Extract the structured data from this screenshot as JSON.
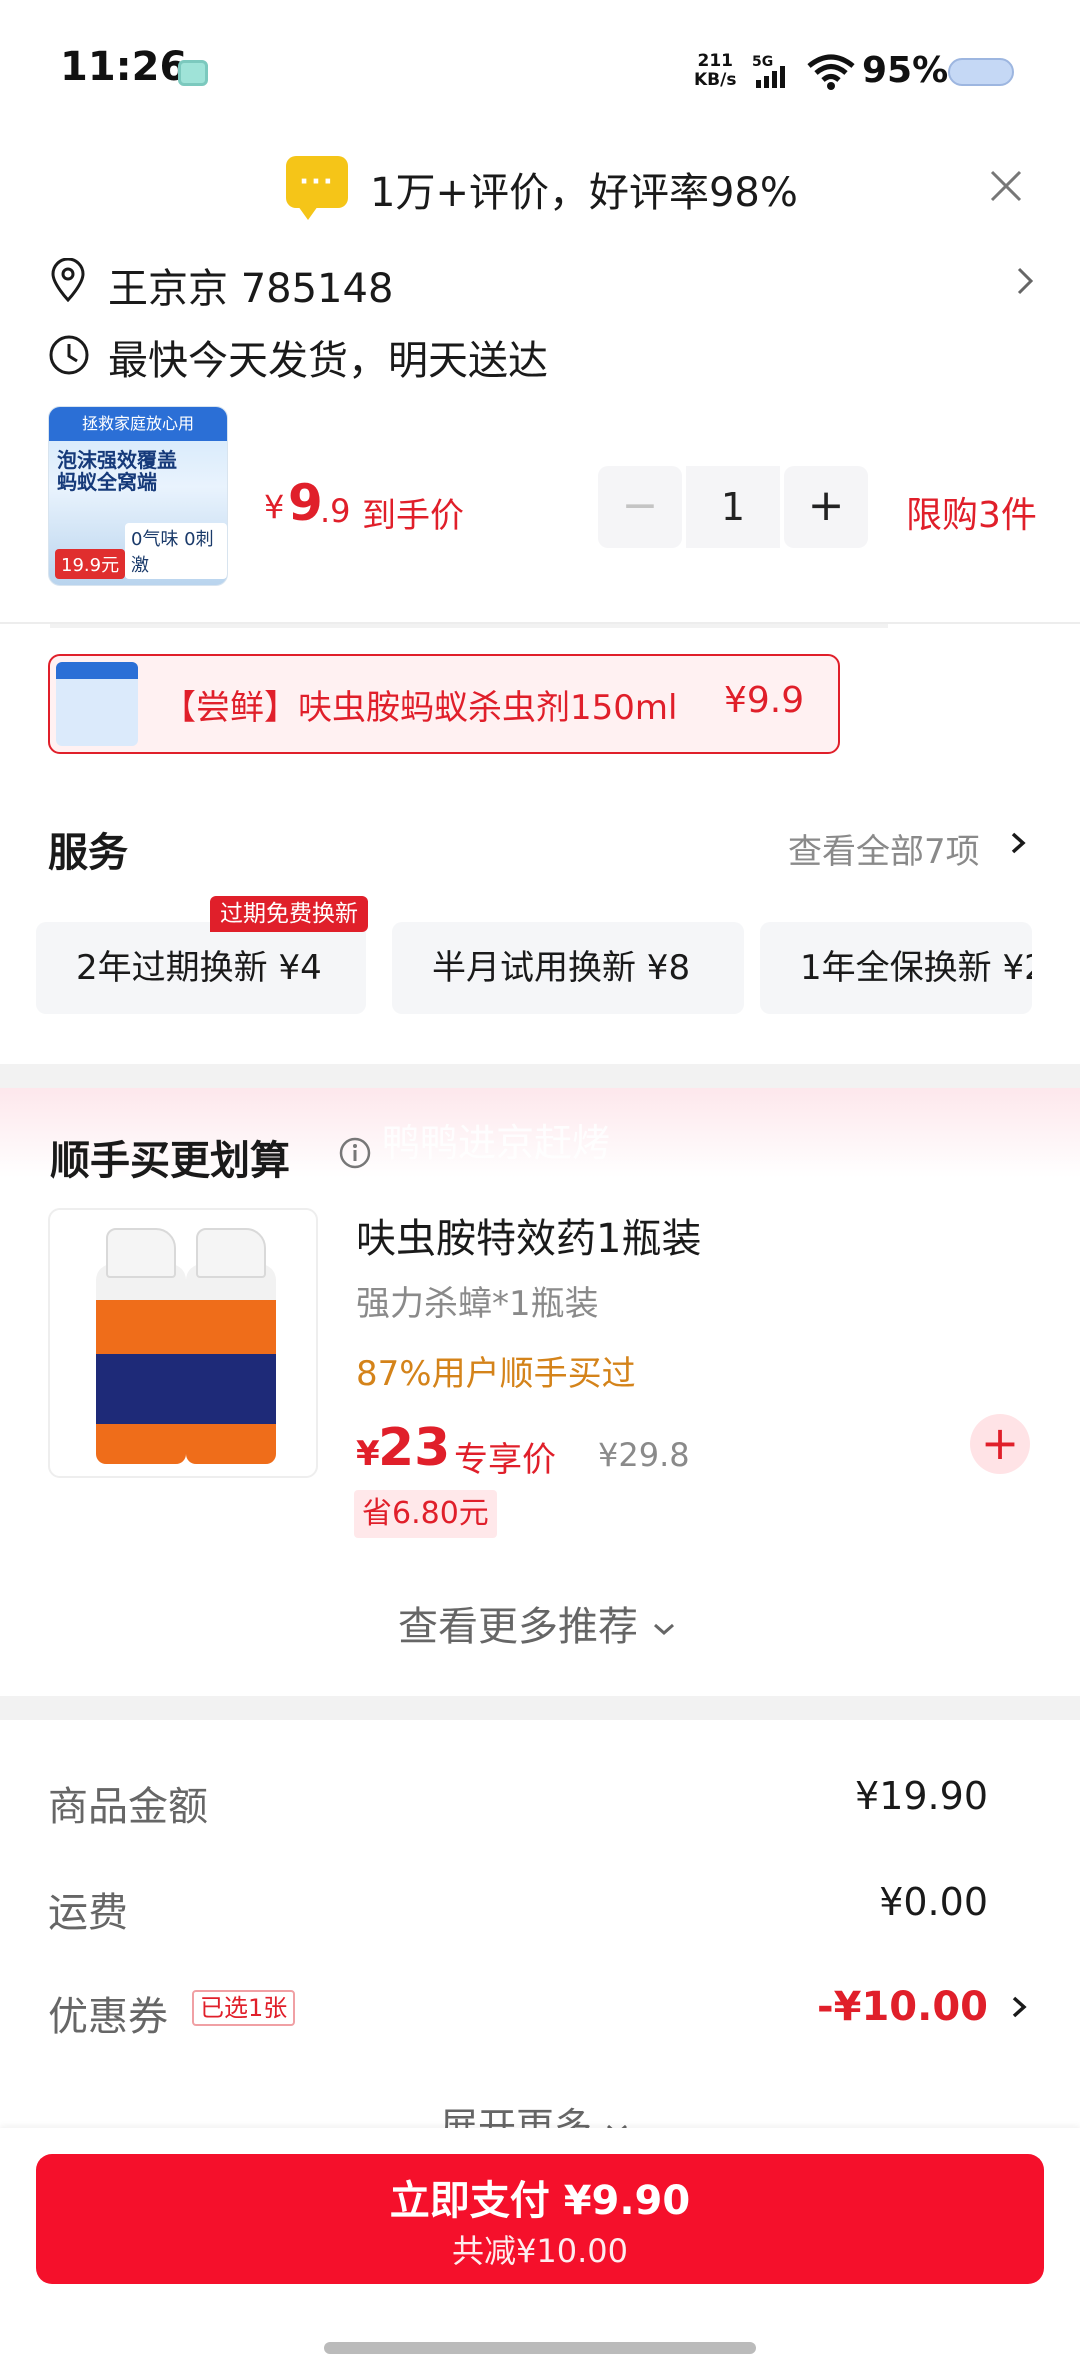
{
  "status_bar": {
    "time": "11:26",
    "speed_value": "211",
    "speed_unit": "KB/s",
    "network": "5G",
    "battery": "95%"
  },
  "review_banner": {
    "text": "1万+评价，好评率98%"
  },
  "address": {
    "text": "王京京  785148",
    "delivery": "最快今天发货，明天送达"
  },
  "product": {
    "thumb_top": "拯救家庭放心用",
    "thumb_mid": "泡沫强效覆盖\n蚂蚁全窝端",
    "thumb_price": "19.9元",
    "thumb_tag": "0气味 0刺激",
    "price_symbol": "¥",
    "price_int": "9",
    "price_dec": ".9",
    "price_note": "到手价",
    "qty_minus": "−",
    "qty_value": "1",
    "qty_plus": "+",
    "limit": "限购3件"
  },
  "sku": {
    "label": "【尝鲜】呋虫胺蚂蚁杀虫剂150ml",
    "price": "¥9.9"
  },
  "services": {
    "title": "服务",
    "more": "查看全部7项",
    "badge": "过期免费换新",
    "items": [
      {
        "label": "2年过期换新  ¥4"
      },
      {
        "label": "半月试用换新  ¥8"
      },
      {
        "label": "1年全保换新  ¥2"
      }
    ]
  },
  "recommendation": {
    "watermark": "鸭鸭进京赶烤",
    "title": "顺手买更划算",
    "name": "呋虫胺特效药1瓶装",
    "spec": "强力杀蟑*1瓶装",
    "users": "87%用户顺手买过",
    "price_symbol": "¥",
    "price": "23",
    "price_note": "专享价",
    "original_price": "¥29.8",
    "save": "省6.80元",
    "add": "+",
    "see_more": "查看更多推荐"
  },
  "summary": {
    "goods_label": "商品金额",
    "goods_value": "¥19.90",
    "shipping_label": "运费",
    "shipping_value": "¥0.00",
    "coupon_label": "优惠券",
    "coupon_tag": "已选1张",
    "coupon_value": "-¥10.00",
    "expand": "展开更多"
  },
  "pay": {
    "main": "立即支付 ¥9.90",
    "sub": "共减¥10.00"
  },
  "colors": {
    "accent_red": "#e01f2a",
    "pay_button": "#f5102b",
    "orange_text": "#d4831a",
    "muted_text": "#8a8a8a"
  }
}
